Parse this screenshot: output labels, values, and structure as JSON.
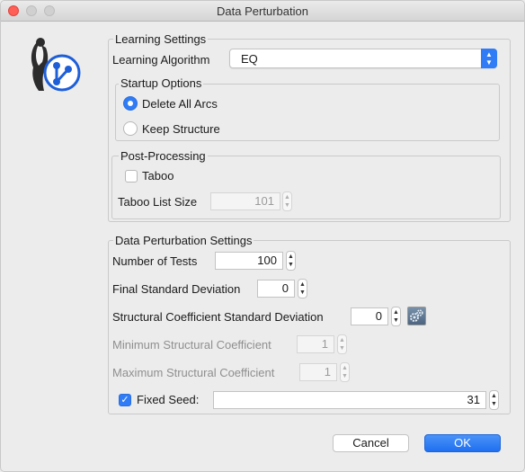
{
  "window": {
    "title": "Data Perturbation"
  },
  "learning_settings": {
    "legend": "Learning Settings",
    "algorithm_label": "Learning Algorithm",
    "algorithm_value": "EQ",
    "startup": {
      "legend": "Startup Options",
      "options": [
        {
          "label": "Delete All Arcs",
          "selected": true
        },
        {
          "label": "Keep Structure",
          "selected": false
        }
      ]
    },
    "post_processing": {
      "legend": "Post-Processing",
      "taboo_label": "Taboo",
      "taboo_checked": false,
      "taboo_list_size_label": "Taboo List Size",
      "taboo_list_size_value": "101"
    }
  },
  "perturbation": {
    "legend": "Data Perturbation Settings",
    "num_tests_label": "Number of Tests",
    "num_tests_value": "100",
    "final_sd_label": "Final Standard Deviation",
    "final_sd_value": "0",
    "struct_sd_label": "Structural Coefficient Standard Deviation",
    "struct_sd_value": "0",
    "min_coef_label": "Minimum Structural Coefficient",
    "min_coef_value": "1",
    "max_coef_label": "Maximum Structural Coefficient",
    "max_coef_value": "1",
    "fixed_seed_label": "Fixed Seed:",
    "fixed_seed_checked": true,
    "fixed_seed_value": "31"
  },
  "buttons": {
    "cancel": "Cancel",
    "ok": "OK"
  },
  "colors": {
    "accent": "#2f7cf6",
    "close": "#ff5f57"
  }
}
